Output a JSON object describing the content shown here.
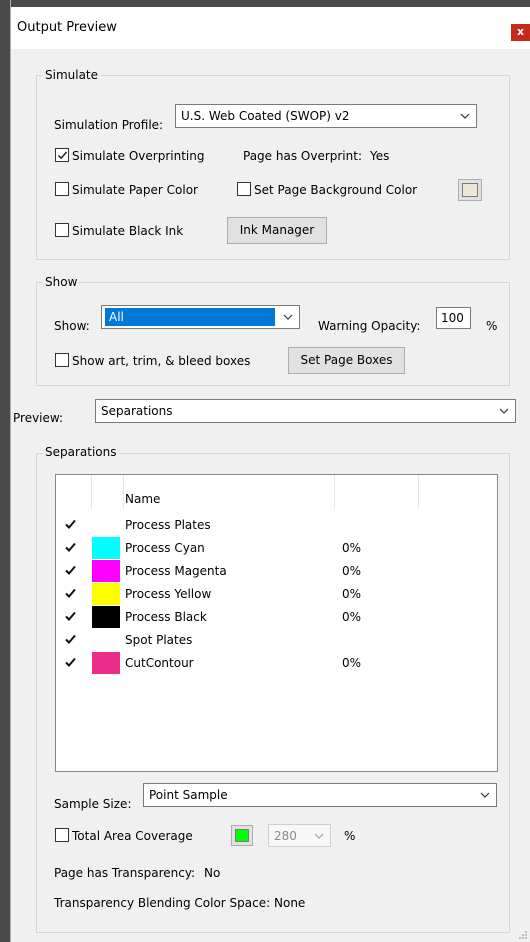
{
  "window": {
    "title": "Output Preview",
    "close_label": "x"
  },
  "simulate": {
    "group_label": "Simulate",
    "profile_label": "Simulation Profile:",
    "profile_value": "U.S. Web Coated (SWOP) v2",
    "overprint_label": "Simulate Overprinting",
    "overprint_checked": true,
    "page_overprint_label": "Page has Overprint:",
    "page_overprint_value": "Yes",
    "paper_color_label": "Simulate Paper Color",
    "page_bg_label": "Set Page Background Color",
    "page_bg_color": "#ede8d6",
    "black_ink_label": "Simulate Black Ink",
    "ink_manager_label": "Ink Manager"
  },
  "show": {
    "group_label": "Show",
    "show_label": "Show:",
    "show_value": "All",
    "warning_opacity_label": "Warning Opacity:",
    "warning_opacity_value": "100",
    "percent": "%",
    "boxes_label": "Show art, trim, & bleed boxes",
    "set_page_boxes_label": "Set Page Boxes"
  },
  "preview": {
    "label": "Preview:",
    "value": "Separations"
  },
  "separations": {
    "group_label": "Separations",
    "name_header": "Name",
    "rows": [
      {
        "name": "Process Plates",
        "swatch": "",
        "pct": "",
        "checked": true
      },
      {
        "name": "Process Cyan",
        "swatch": "#00ffff",
        "pct": "0%",
        "checked": true
      },
      {
        "name": "Process Magenta",
        "swatch": "#ff00ff",
        "pct": "0%",
        "checked": true
      },
      {
        "name": "Process Yellow",
        "swatch": "#ffff00",
        "pct": "0%",
        "checked": true
      },
      {
        "name": "Process Black",
        "swatch": "#000000",
        "pct": "0%",
        "checked": true
      },
      {
        "name": "Spot Plates",
        "swatch": "",
        "pct": "",
        "checked": true
      },
      {
        "name": "CutContour",
        "swatch": "#ed2d8c",
        "pct": "0%",
        "checked": true
      }
    ],
    "sample_size_label": "Sample Size:",
    "sample_size_value": "Point Sample",
    "tac_label": "Total Area Coverage",
    "tac_color": "#00ff00",
    "tac_value": "280",
    "tac_percent": "%",
    "transparency_label": "Page has Transparency:",
    "transparency_value": "No",
    "blending_label": "Transparency Blending Color Space:",
    "blending_value": "None"
  }
}
